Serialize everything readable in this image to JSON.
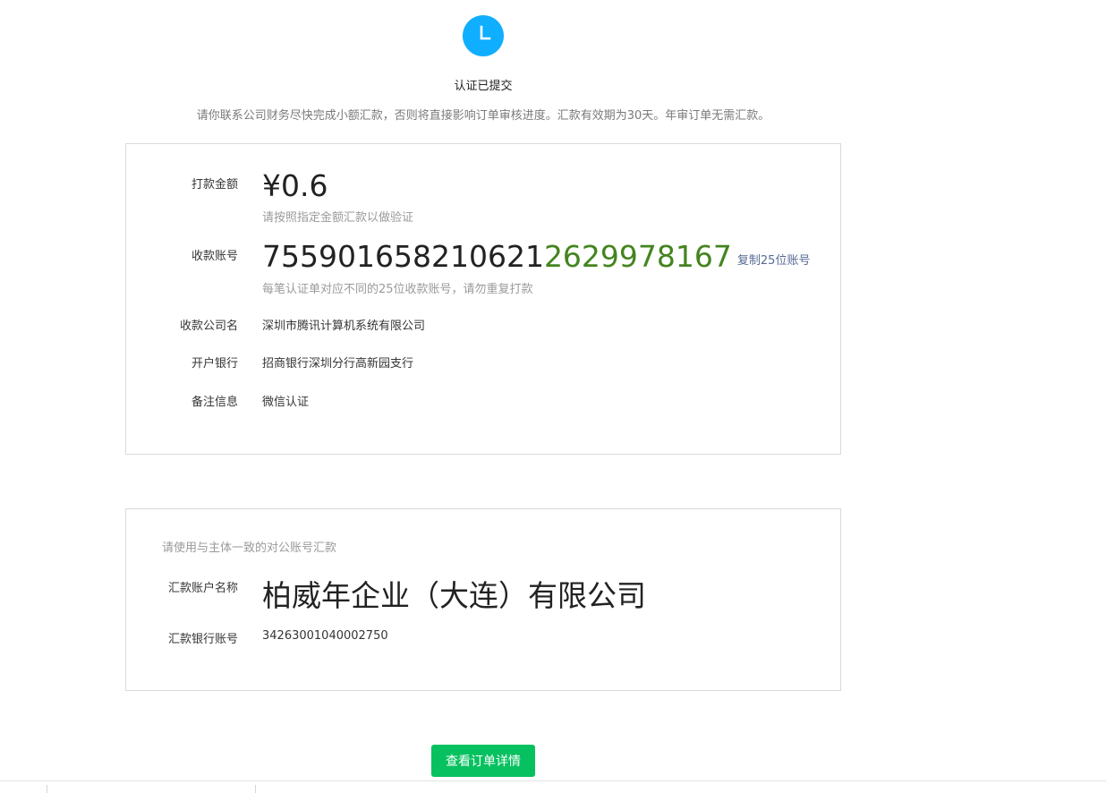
{
  "status": {
    "icon": "clock-icon",
    "icon_color": "#10aeff",
    "title": "认证已提交",
    "description": "请你联系公司财务尽快完成小额汇款，否则将直接影响订单审核进度。汇款有效期为30天。年审订单无需汇款。"
  },
  "remittance": {
    "amount_label": "打款金额",
    "amount_value": "¥0.6",
    "amount_hint": "请按照指定金额汇款以做验证",
    "account_label": "收款账号",
    "account_prefix": "755901658210621",
    "account_suffix": "2629978167",
    "account_suffix_color": "#44841f",
    "copy_label": "复制25位账号",
    "account_hint": "每笔认证单对应不同的25位收款账号，请勿重复打款",
    "company_label": "收款公司名",
    "company_value": "深圳市腾讯计算机系统有限公司",
    "bank_label": "开户银行",
    "bank_value": "招商银行深圳分行高新园支行",
    "remark_label": "备注信息",
    "remark_value": "微信认证"
  },
  "payer": {
    "note": "请使用与主体一致的对公账号汇款",
    "name_label": "汇款账户名称",
    "name_value": "柏威年企业（大连）有限公司",
    "account_label": "汇款银行账号",
    "account_value": "34263001040002750"
  },
  "actions": {
    "view_order_label": "查看订单详情",
    "button_color": "#07c160"
  }
}
